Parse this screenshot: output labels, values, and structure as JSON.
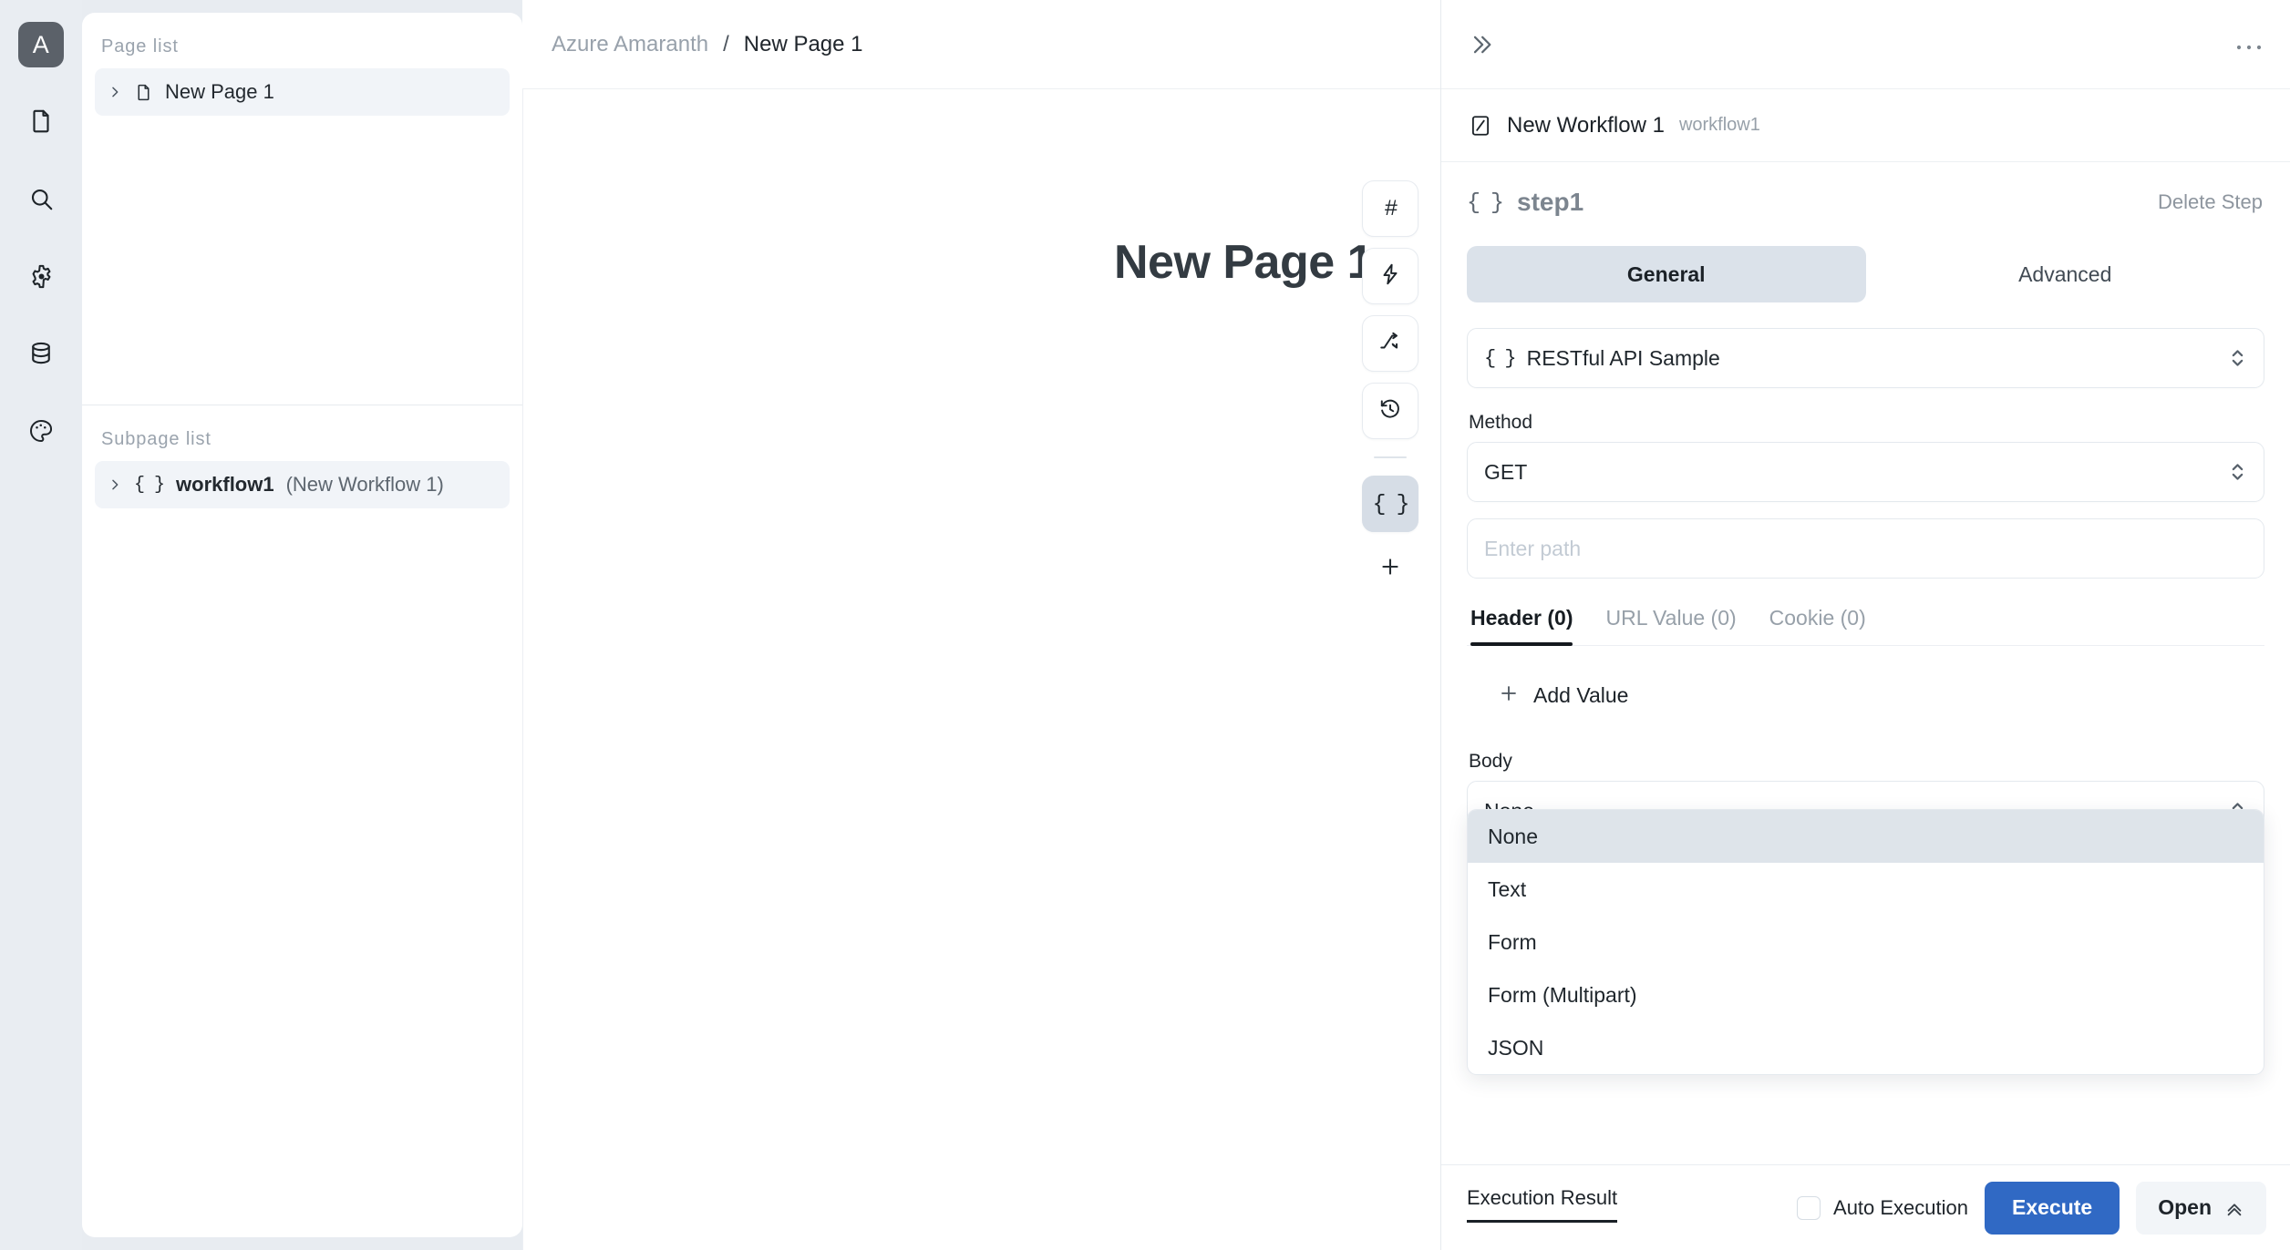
{
  "rail": {
    "logo_label": "A",
    "items": [
      {
        "icon": "document-icon",
        "name": "rail-item-pages"
      },
      {
        "icon": "search-icon",
        "name": "rail-item-search"
      },
      {
        "icon": "gear-icon",
        "name": "rail-item-settings"
      },
      {
        "icon": "database-icon",
        "name": "rail-item-data"
      },
      {
        "icon": "palette-icon",
        "name": "rail-item-theme"
      }
    ]
  },
  "page_list": {
    "section_label": "Page list",
    "items": [
      {
        "label": "New Page 1",
        "selected": true
      }
    ],
    "subpage_section_label": "Subpage list",
    "subpages": [
      {
        "mono": "{ }",
        "label": "workflow1",
        "sub": "(New Workflow 1)",
        "selected": true
      }
    ]
  },
  "breadcrumb": {
    "root": "Azure Amaranth",
    "separator": "/",
    "current": "New Page 1"
  },
  "canvas": {
    "title": "New Page 1",
    "toolbar": [
      {
        "glyph": "#",
        "name": "toolbar-hash",
        "active": false
      },
      {
        "glyph": "bolt",
        "name": "toolbar-action",
        "active": false
      },
      {
        "glyph": "shuffle",
        "name": "toolbar-flow",
        "active": false
      },
      {
        "glyph": "history",
        "name": "toolbar-history",
        "active": false
      },
      {
        "glyph": "{ }",
        "name": "toolbar-workflow",
        "active": true
      }
    ],
    "add_label": "+"
  },
  "panel": {
    "collapse_icon": "chevron-double-right-icon",
    "more_icon": "ellipsis-icon",
    "workflow": {
      "name": "New Workflow 1",
      "id": "workflow1"
    },
    "step": {
      "mono": "{ }",
      "name": "step1",
      "delete_label": "Delete Step"
    },
    "tabs": [
      {
        "label": "General",
        "active": true
      },
      {
        "label": "Advanced",
        "active": false
      }
    ],
    "resource": {
      "mono": "{ }",
      "value": "RESTful API Sample"
    },
    "method": {
      "label": "Method",
      "value": "GET"
    },
    "path": {
      "placeholder": "Enter path",
      "value": ""
    },
    "param_tabs": [
      {
        "label": "Header (0)",
        "active": true
      },
      {
        "label": "URL Value (0)",
        "active": false
      },
      {
        "label": "Cookie (0)",
        "active": false
      }
    ],
    "add_value_label": "Add Value",
    "body": {
      "label": "Body",
      "value": "None",
      "options": [
        {
          "label": "None",
          "highlighted": true
        },
        {
          "label": "Text",
          "highlighted": false
        },
        {
          "label": "Form",
          "highlighted": false
        },
        {
          "label": "Form (Multipart)",
          "highlighted": false
        },
        {
          "label": "JSON",
          "highlighted": false
        }
      ]
    },
    "bottom": {
      "execution_result_label": "Execution Result",
      "auto_execution_label": "Auto Execution",
      "auto_execution_checked": false,
      "execute_label": "Execute",
      "open_label": "Open"
    }
  },
  "colors": {
    "accent": "#3069c4",
    "rail_bg": "#e9edf2",
    "selected_bg": "#dbe2ea",
    "highlight_bg": "#dee4ea",
    "logo_bg": "#5b6169"
  }
}
